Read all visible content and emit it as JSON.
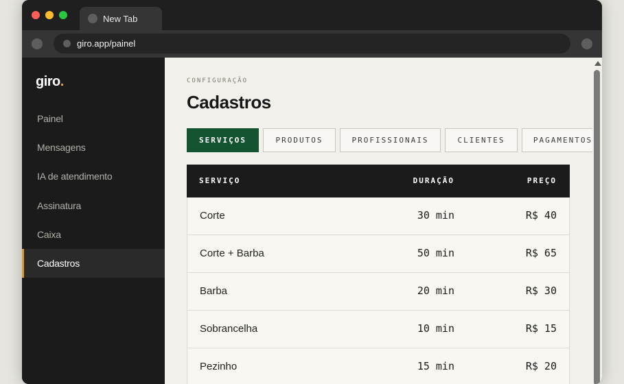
{
  "browser": {
    "tab_title": "New Tab",
    "url": "giro.app/painel"
  },
  "sidebar": {
    "logo_text": "giro",
    "logo_dot": ".",
    "items": [
      {
        "label": "Painel",
        "active": false
      },
      {
        "label": "Mensagens",
        "active": false
      },
      {
        "label": "IA de atendimento",
        "active": false
      },
      {
        "label": "Assinatura",
        "active": false
      },
      {
        "label": "Caixa",
        "active": false
      },
      {
        "label": "Cadastros",
        "active": true
      }
    ]
  },
  "page": {
    "eyebrow": "CONFIGURAÇÃO",
    "title": "Cadastros",
    "tabs": [
      {
        "label": "SERVIÇOS",
        "active": true
      },
      {
        "label": "PRODUTOS",
        "active": false
      },
      {
        "label": "PROFISSIONAIS",
        "active": false
      },
      {
        "label": "CLIENTES",
        "active": false
      },
      {
        "label": "PAGAMENTOS",
        "active": false
      }
    ]
  },
  "table": {
    "headers": {
      "service": "SERVIÇO",
      "duration": "DURAÇÃO",
      "price": "PREÇO"
    },
    "rows": [
      {
        "name": "Corte",
        "duration": "30 min",
        "price": "R$ 40"
      },
      {
        "name": "Corte + Barba",
        "duration": "50 min",
        "price": "R$ 65"
      },
      {
        "name": "Barba",
        "duration": "20 min",
        "price": "R$ 30"
      },
      {
        "name": "Sobrancelha",
        "duration": "10 min",
        "price": "R$ 15"
      },
      {
        "name": "Pezinho",
        "duration": "15 min",
        "price": "R$ 20"
      }
    ]
  },
  "colors": {
    "accent_green": "#14532f",
    "accent_gold": "#d59a3c",
    "sidebar_bg": "#1b1b1b",
    "content_bg": "#f2f0ea"
  }
}
